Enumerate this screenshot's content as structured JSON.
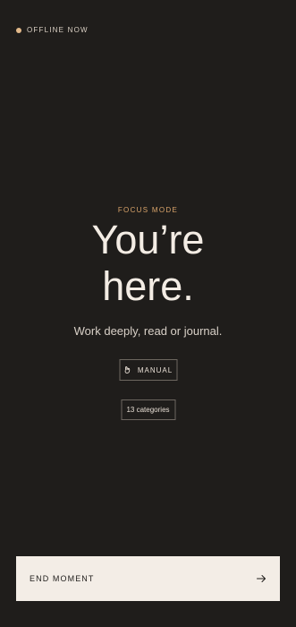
{
  "status": {
    "label": "OFFLINE NOW",
    "dot_color": "#e2b98a"
  },
  "focus": {
    "eyebrow": "FOCUS MODE",
    "title_line1": "You’re",
    "title_line2": "here.",
    "subtitle": "Work deeply, read or journal."
  },
  "chips": {
    "manual_label": "MANUAL",
    "manual_icon": "hand-icon",
    "categories_label": "13 categories"
  },
  "cta": {
    "label": "END MOMENT",
    "icon": "arrow-right-icon"
  },
  "colors": {
    "background": "#1f1d1b",
    "accent": "#d8a36a",
    "button_bg": "#f3ede6"
  }
}
